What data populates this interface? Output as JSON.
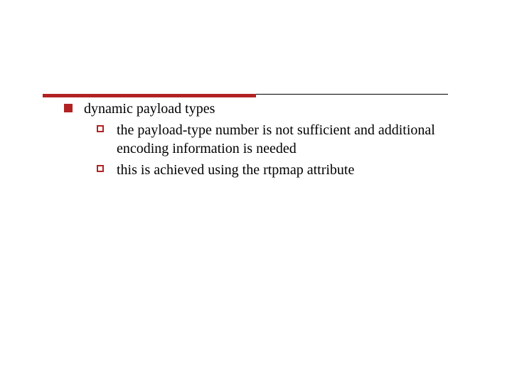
{
  "colors": {
    "accent": "#b22222",
    "text": "#000000",
    "background": "#ffffff"
  },
  "bullets": {
    "level1": {
      "icon": "filled-square",
      "text": "dynamic payload types",
      "children": [
        {
          "icon": "hollow-square",
          "text": "the payload-type number is not sufficient and additional encoding information is needed"
        },
        {
          "icon": "hollow-square",
          "text": "this is achieved using the rtpmap attribute"
        }
      ]
    }
  }
}
